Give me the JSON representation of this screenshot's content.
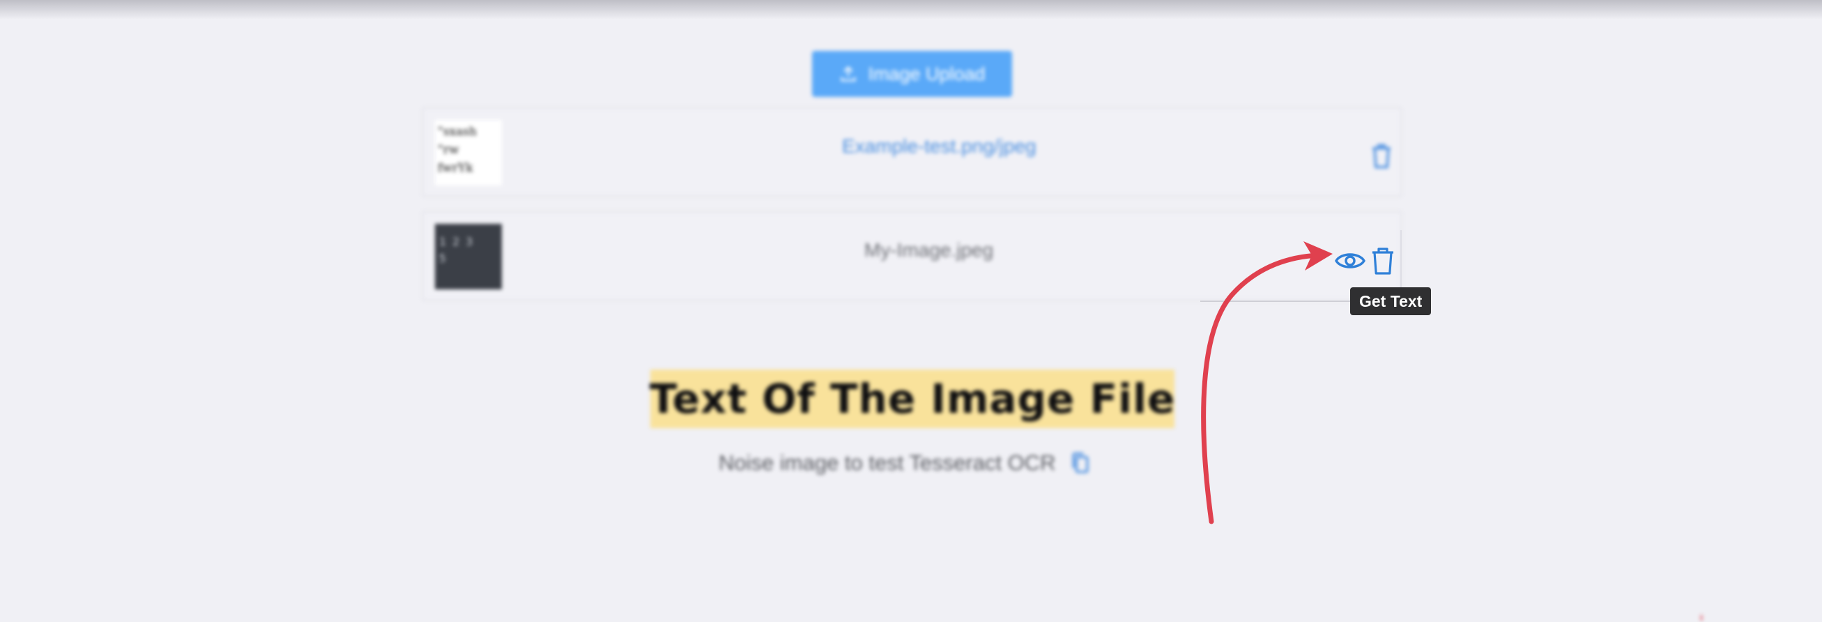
{
  "upload": {
    "label": "Image Upload",
    "icon": "upload-icon"
  },
  "files": [
    {
      "name": "Example-test.png/jpeg",
      "thumb_text": "\"sxash\n\"rw\nfwrYk",
      "actions": [
        "trash-icon"
      ]
    },
    {
      "name": "My-Image.jpeg",
      "thumb_text": "1 2 3\n5",
      "actions": [
        "eye-icon",
        "trash-icon"
      ]
    }
  ],
  "tooltip": {
    "text": "Get Text"
  },
  "result": {
    "heading": "Text Of The Image File",
    "ocr_text": "Noise image to test Tesseract OCR"
  },
  "colors": {
    "accent": "#4a8fe0",
    "upload_button": "#5aa9f8",
    "highlight": "#f9e29b",
    "annotation_arrow": "#e0404e",
    "tooltip_bg": "#2f2f31"
  }
}
